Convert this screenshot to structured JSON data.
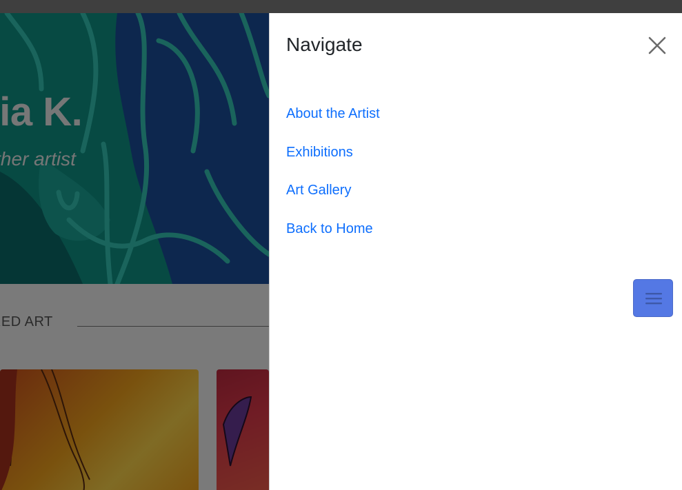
{
  "hero": {
    "title": "ilia K.",
    "subtitle": "nother artist"
  },
  "featured": {
    "heading": "URED ART"
  },
  "drawer": {
    "title": "Navigate",
    "close_icon": "close-icon",
    "links": [
      {
        "label": "About the Artist"
      },
      {
        "label": "Exhibitions"
      },
      {
        "label": "Art Gallery"
      },
      {
        "label": "Back to Home"
      }
    ]
  },
  "menu_toggle": {
    "icon": "hamburger-icon"
  },
  "colors": {
    "link": "#0d6efd",
    "toggle": "#5478e4",
    "hero_teal": "#0d8f84"
  }
}
